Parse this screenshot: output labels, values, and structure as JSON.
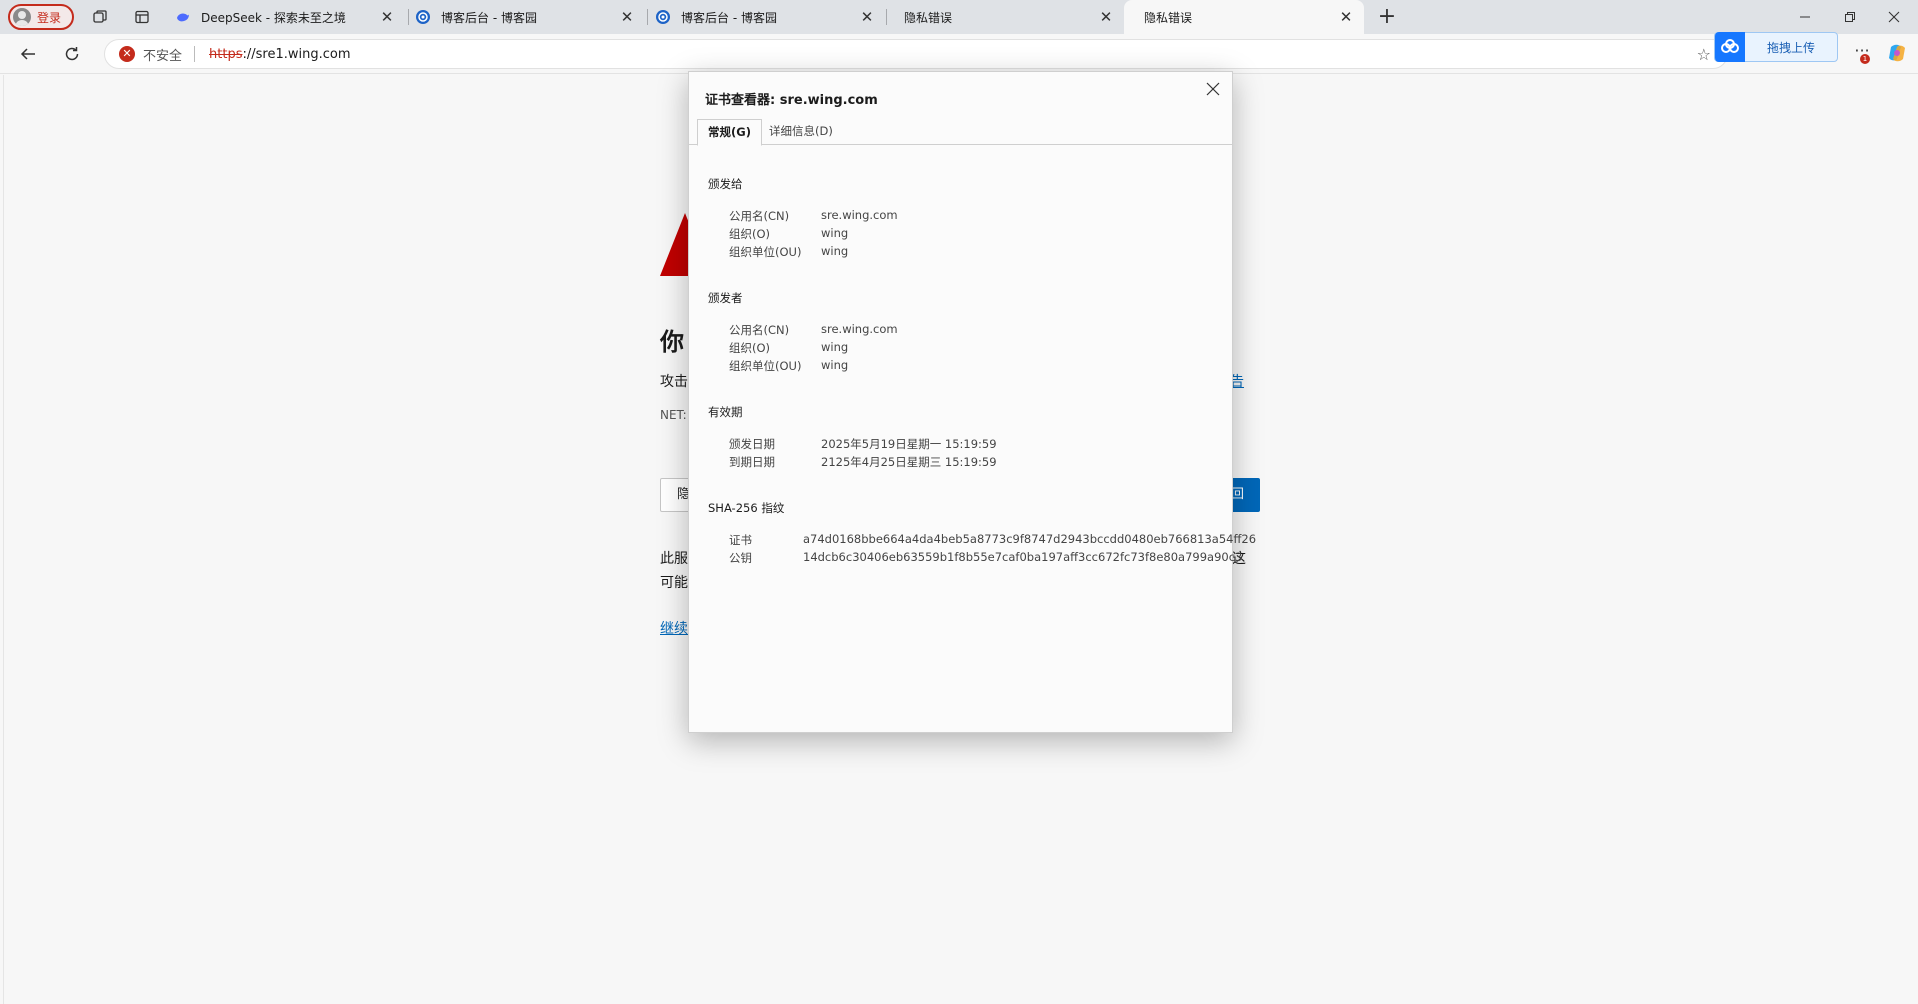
{
  "tabstrip": {
    "profile_label": "登录",
    "tabs": [
      {
        "title": "DeepSeek - 探索未至之境",
        "favicon": "deepseek-whale-icon"
      },
      {
        "title": "博客后台 - 博客园",
        "favicon": "cnblogs-icon"
      },
      {
        "title": "博客后台 - 博客园",
        "favicon": "cnblogs-icon"
      },
      {
        "title": "隐私错误",
        "favicon": ""
      },
      {
        "title": "隐私错误",
        "favicon": "",
        "active": true
      }
    ],
    "new_tab": "+"
  },
  "navbar": {
    "security_label": "不安全",
    "url_scheme": "https",
    "url_rest": "://sre1.wing.com",
    "upload_label": "拖拽上传",
    "notification_count": "1"
  },
  "error_page": {
    "heading": "你",
    "text1": "攻击",
    "link1": "告",
    "code": "NET::",
    "btn_secondary": "隐",
    "btn_primary": "回",
    "text2": "此服",
    "text2_end": "这",
    "text3": "可能",
    "link2": "继续"
  },
  "dialog": {
    "title": "证书查看器: sre.wing.com",
    "tabs": [
      "常规(G)",
      "详细信息(D)"
    ],
    "issued_to": {
      "heading": "颁发给",
      "rows": [
        {
          "key": "公用名(CN)",
          "value": "sre.wing.com"
        },
        {
          "key": "组织(O)",
          "value": "wing"
        },
        {
          "key": "组织单位(OU)",
          "value": "wing"
        }
      ]
    },
    "issued_by": {
      "heading": "颁发者",
      "rows": [
        {
          "key": "公用名(CN)",
          "value": "sre.wing.com"
        },
        {
          "key": "组织(O)",
          "value": "wing"
        },
        {
          "key": "组织单位(OU)",
          "value": "wing"
        }
      ]
    },
    "validity": {
      "heading": "有效期",
      "rows": [
        {
          "key": "颁发日期",
          "value": "2025年5月19日星期一 15:19:59"
        },
        {
          "key": "到期日期",
          "value": "2125年4月25日星期三 15:19:59"
        }
      ]
    },
    "fingerprints": {
      "heading": "SHA-256 指纹",
      "rows": [
        {
          "key": "证书",
          "value": "a74d0168bbe664a4da4beb5a8773c9f8747d2943bccdd0480eb766813a54ff26"
        },
        {
          "key": "公钥",
          "value": "14dcb6c30406eb63559b1f8b55e7caf0ba197aff3cc672fc73f8e80a799a90c3"
        }
      ]
    }
  },
  "colors": {
    "danger": "#c42b1c",
    "link": "#0067b8",
    "upload_blue": "#1677ff"
  }
}
